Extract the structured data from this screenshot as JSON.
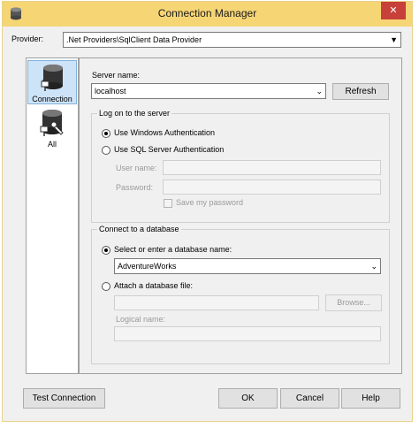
{
  "window": {
    "title": "Connection Manager",
    "close_glyph": "✕"
  },
  "provider": {
    "label": "Provider:",
    "value": ".Net Providers\\SqlClient Data Provider"
  },
  "sidebar": {
    "items": [
      {
        "label": "Connection",
        "icon": "database-plug-icon",
        "selected": true
      },
      {
        "label": "All",
        "icon": "database-wrench-icon",
        "selected": false
      }
    ]
  },
  "server": {
    "label": "Server name:",
    "value": "localhost",
    "refresh_label": "Refresh"
  },
  "logon": {
    "group_title": "Log on to the server",
    "windows_auth_label": "Use Windows Authentication",
    "sql_auth_label": "Use SQL Server Authentication",
    "username_label": "User name:",
    "password_label": "Password:",
    "save_password_label": "Save my password"
  },
  "database": {
    "group_title": "Connect to a database",
    "select_label": "Select or enter a database name:",
    "db_value": "AdventureWorks",
    "attach_label": "Attach a database file:",
    "browse_label": "Browse...",
    "logical_label": "Logical name:"
  },
  "footer": {
    "test_label": "Test Connection",
    "ok_label": "OK",
    "cancel_label": "Cancel",
    "help_label": "Help"
  },
  "colors": {
    "titlebar": "#f6d575",
    "close": "#c7403a",
    "selected_nav": "#cde3f7"
  }
}
